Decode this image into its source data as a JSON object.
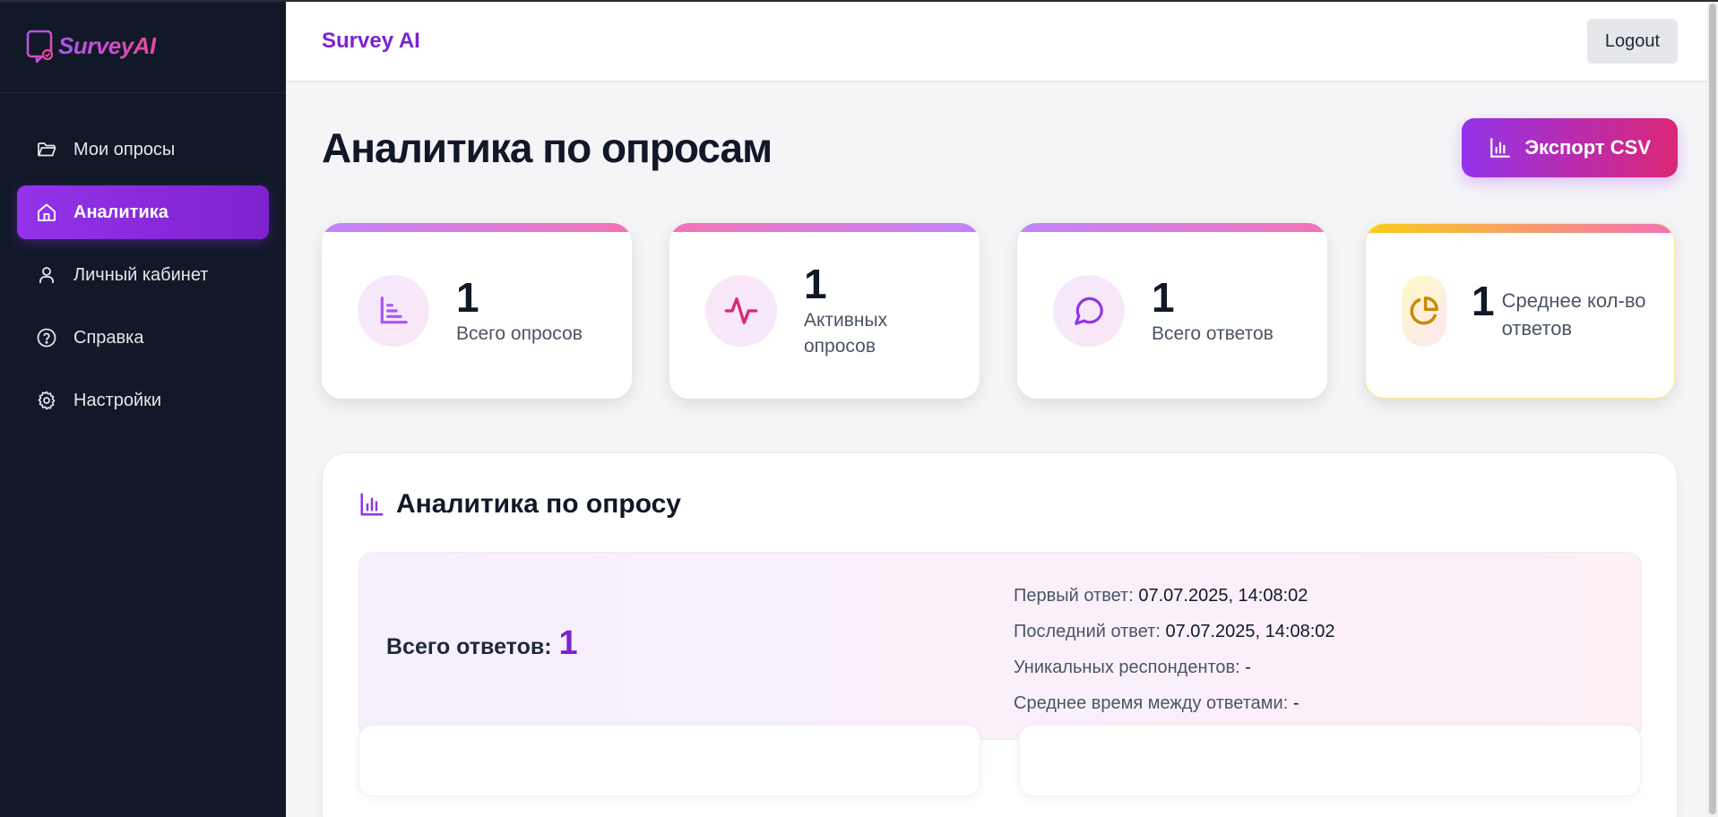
{
  "brand_logo_text": "SurveyAI",
  "sidebar": {
    "items": [
      {
        "label": "Мои опросы",
        "icon": "folder-icon",
        "active": false
      },
      {
        "label": "Аналитика",
        "icon": "home-icon",
        "active": true
      },
      {
        "label": "Личный кабинет",
        "icon": "user-icon",
        "active": false
      },
      {
        "label": "Справка",
        "icon": "help-circle-icon",
        "active": false
      },
      {
        "label": "Настройки",
        "icon": "gear-icon",
        "active": false
      }
    ]
  },
  "header": {
    "title": "Survey AI",
    "logout_label": "Logout"
  },
  "main": {
    "page_title": "Аналитика по опросам",
    "export_label": "Экспорт CSV",
    "cards": [
      {
        "value": "1",
        "label": "Всего опросов",
        "icon": "bar-chart-icon",
        "accent": "#a855f7"
      },
      {
        "value": "1",
        "label": "Активных опросов",
        "icon": "activity-icon",
        "accent": "#db2777"
      },
      {
        "value": "1",
        "label": "Всего ответов",
        "icon": "message-circle-icon",
        "accent": "#a855f7"
      },
      {
        "value": "1",
        "label": "Среднее кол-во ответов",
        "icon": "pie-chart-icon",
        "accent": "#ca8a04"
      }
    ],
    "panel": {
      "title": "Аналитика по опросу",
      "total_label": "Всего ответов:",
      "total_value": "1",
      "stats": [
        {
          "label": "Первый ответ:",
          "value": "07.07.2025, 14:08:02"
        },
        {
          "label": "Последний ответ:",
          "value": "07.07.2025, 14:08:02"
        },
        {
          "label": "Уникальных респондентов:",
          "value": "-"
        },
        {
          "label": "Среднее время между ответами:",
          "value": "-"
        }
      ]
    }
  },
  "colors": {
    "sidebar_bg": "#111827",
    "accent_purple": "#9333ea",
    "accent_pink": "#db2777",
    "brand": "#7e22ce"
  }
}
